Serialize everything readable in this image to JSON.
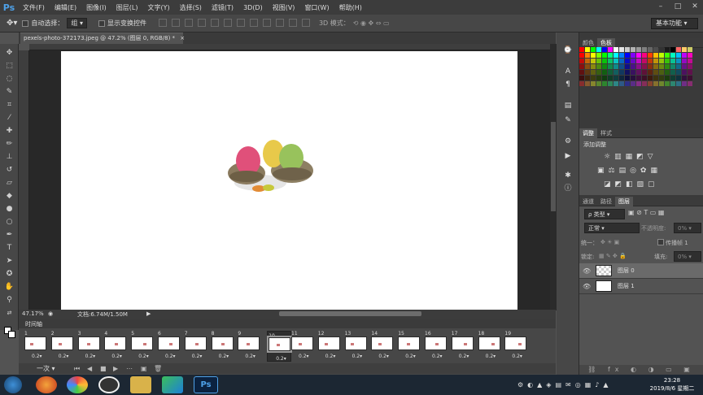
{
  "app": {
    "logo": "Ps"
  },
  "menu": [
    "文件(F)",
    "编辑(E)",
    "图像(I)",
    "图层(L)",
    "文字(Y)",
    "选择(S)",
    "滤镜(T)",
    "3D(D)",
    "视图(V)",
    "窗口(W)",
    "帮助(H)"
  ],
  "window_controls": {
    "minimize": "–",
    "restore": "□",
    "close": "✕"
  },
  "options": {
    "auto_select_label": "自动选择：",
    "auto_select_value": "组",
    "show_transform_label": "显示变换控件",
    "mode_3d_label": "3D 模式：",
    "workspace": "基本功能"
  },
  "document": {
    "tab_title": "pexels-photo-372173.jpeg @ 47.2% (图层 0, RGB/8) *",
    "tab_close": "×",
    "zoom": "47.17%",
    "doc_info": "文档:6.74M/1.50M"
  },
  "timeline": {
    "title": "时间轴",
    "frames": [
      {
        "num": "1",
        "delay": "0.2▾"
      },
      {
        "num": "2",
        "delay": "0.2▾"
      },
      {
        "num": "3",
        "delay": "0.2▾"
      },
      {
        "num": "4",
        "delay": "0.2▾"
      },
      {
        "num": "5",
        "delay": "0.2▾"
      },
      {
        "num": "6",
        "delay": "0.2▾"
      },
      {
        "num": "7",
        "delay": "0.2▾"
      },
      {
        "num": "8",
        "delay": "0.2▾"
      },
      {
        "num": "9",
        "delay": "0.2▾"
      },
      {
        "num": "10",
        "delay": "0.2▾"
      },
      {
        "num": "11",
        "delay": "0.2▾"
      },
      {
        "num": "12",
        "delay": "0.2▾"
      },
      {
        "num": "13",
        "delay": "0.2▾"
      },
      {
        "num": "14",
        "delay": "0.2▾"
      },
      {
        "num": "15",
        "delay": "0.2▾"
      },
      {
        "num": "16",
        "delay": "0.2▾"
      },
      {
        "num": "17",
        "delay": "0.2▾"
      },
      {
        "num": "18",
        "delay": "0.2▾"
      },
      {
        "num": "19",
        "delay": "0.2▾"
      }
    ],
    "selected_frame": 10,
    "loop": "一次"
  },
  "panels": {
    "swatch_tabs": [
      "颜色",
      "色板"
    ],
    "adjust_tabs": [
      "调整",
      "样式"
    ],
    "adjust_title": "添加调整",
    "layer_tabs": [
      "通道",
      "路径",
      "图层"
    ],
    "filter_label": "ρ 类型",
    "blend_mode": "正常",
    "opacity_label": "不透明度:",
    "opacity_value": "0%",
    "lock_label": "锁定:",
    "fill_label": "填充:",
    "fill_value": "0%",
    "unify_label": "统一：",
    "propagate_label": "传播帧 1",
    "layers": [
      {
        "name": "图层 0",
        "visible": true
      },
      {
        "name": "图层 1",
        "visible": true
      }
    ]
  },
  "taskbar": {
    "time": "23:28",
    "date": "2019/8/6 星期二",
    "ps_label": "Ps"
  }
}
